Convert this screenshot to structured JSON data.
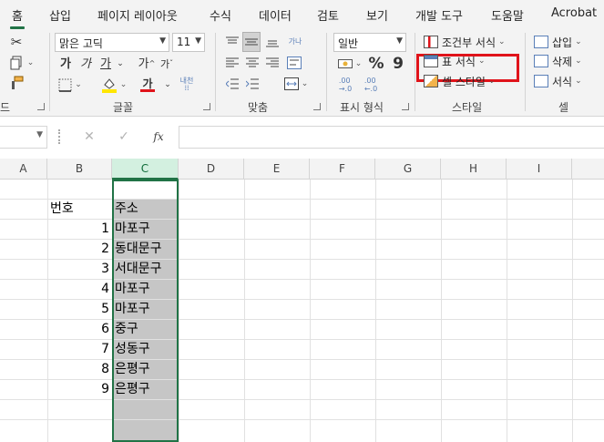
{
  "tabs": [
    "홈",
    "삽입",
    "페이지 레이아웃",
    "수식",
    "데이터",
    "검토",
    "보기",
    "개발 도구",
    "도움말",
    "Acrobat"
  ],
  "active_tab": "홈",
  "ribbon": {
    "font": {
      "name": "맑은 고딕",
      "size": "11",
      "bold": "가",
      "italic": "가",
      "underline": "가",
      "grow": "가",
      "shrink": "가",
      "phonetic": "내천",
      "font_color_glyph": "가",
      "group_label": "글꼴"
    },
    "clipboard": {
      "group_label_partial": "드"
    },
    "alignment": {
      "group_label": "맞춤",
      "wrap_glyph": "가나"
    },
    "number": {
      "format": "일반",
      "percent": "%",
      "comma": "9",
      "inc_decimal": ".00\n→.0",
      "dec_decimal": ".00\n←.0",
      "group_label": "표시 형식"
    },
    "styles": {
      "conditional_format": "조건부 서식",
      "format_as_table": "표 서식",
      "cell_styles": "셀 스타일",
      "group_label": "스타일"
    },
    "cells": {
      "insert": "삽입",
      "delete": "삭제",
      "format": "서식",
      "group_label": "셀"
    }
  },
  "formula_bar": {
    "cancel": "✕",
    "enter": "✓",
    "fx": "fx",
    "value": ""
  },
  "columns": [
    "A",
    "B",
    "C",
    "D",
    "E",
    "F",
    "G",
    "H",
    "I"
  ],
  "selected_column": "C",
  "sheet": {
    "header_number": "번호",
    "header_address": "주소",
    "rows": [
      {
        "num": "1",
        "addr": "마포구"
      },
      {
        "num": "2",
        "addr": "동대문구"
      },
      {
        "num": "3",
        "addr": "서대문구"
      },
      {
        "num": "4",
        "addr": "마포구"
      },
      {
        "num": "5",
        "addr": "마포구"
      },
      {
        "num": "6",
        "addr": "중구"
      },
      {
        "num": "7",
        "addr": "성동구"
      },
      {
        "num": "8",
        "addr": "은평구"
      },
      {
        "num": "9",
        "addr": "은평구"
      }
    ]
  },
  "colors": {
    "accent": "#217346",
    "highlight_box": "#e0131a",
    "selection_fill": "#c6c6c6",
    "font_color_bar": "#e0131a",
    "fill_color_bar": "#ffe600"
  }
}
